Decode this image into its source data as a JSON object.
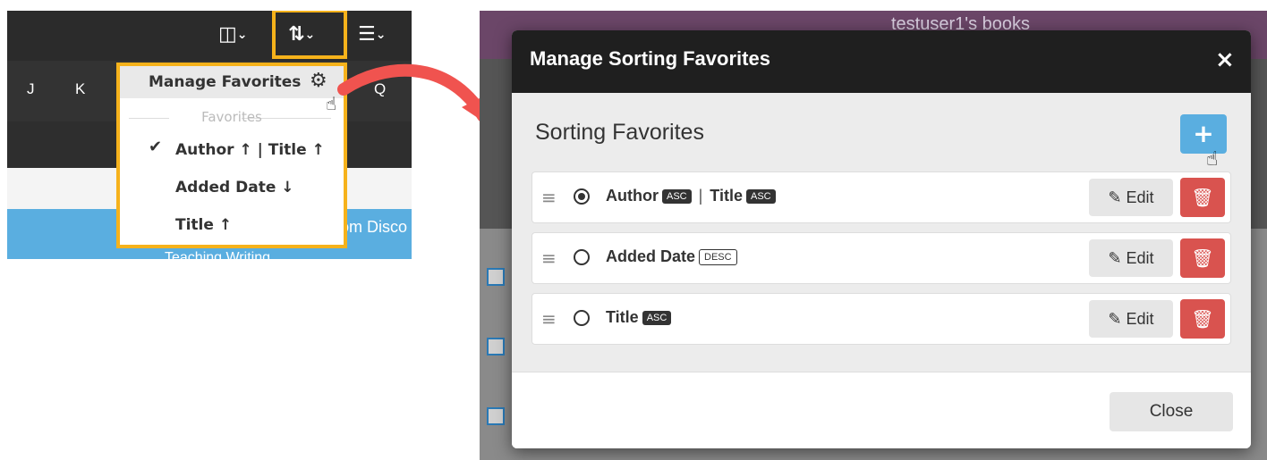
{
  "left": {
    "letters": [
      "J",
      "K",
      "Q"
    ],
    "dropdown": {
      "header_label": "Manage Favorites",
      "favorites_heading": "Favorites",
      "items": [
        {
          "label": "Author ↑ | Title ↑",
          "selected": true
        },
        {
          "label": "Added Date ↓",
          "selected": false
        },
        {
          "label": "Title ↑",
          "selected": false
        }
      ]
    },
    "blue_text": "om Disco",
    "blue_text2": "Teaching Writing",
    "highlight_color": "#f6b21b"
  },
  "right": {
    "page_title": "testuser1's books",
    "modal": {
      "title": "Manage Sorting Favorites",
      "close_x": "×",
      "section_title": "Sorting Favorites",
      "add_label": "+",
      "favorites": [
        {
          "parts": [
            {
              "field": "Author",
              "order": "ASC"
            },
            {
              "field": "Title",
              "order": "ASC"
            }
          ],
          "selected": true
        },
        {
          "parts": [
            {
              "field": "Added Date",
              "order": "DESC"
            }
          ],
          "selected": false
        },
        {
          "parts": [
            {
              "field": "Title",
              "order": "ASC"
            }
          ],
          "selected": false
        }
      ],
      "edit_label": "Edit",
      "close_label": "Close"
    }
  },
  "colors": {
    "accent_blue": "#5aaee0",
    "danger_red": "#d9534f",
    "arrow_red": "#f0534f"
  },
  "icons": [
    "columns-icon",
    "sort-icon",
    "menu-icon",
    "gear-icon",
    "hand-cursor-icon",
    "drag-handle-icon",
    "pencil-icon",
    "trash-icon",
    "close-icon",
    "plus-icon"
  ]
}
